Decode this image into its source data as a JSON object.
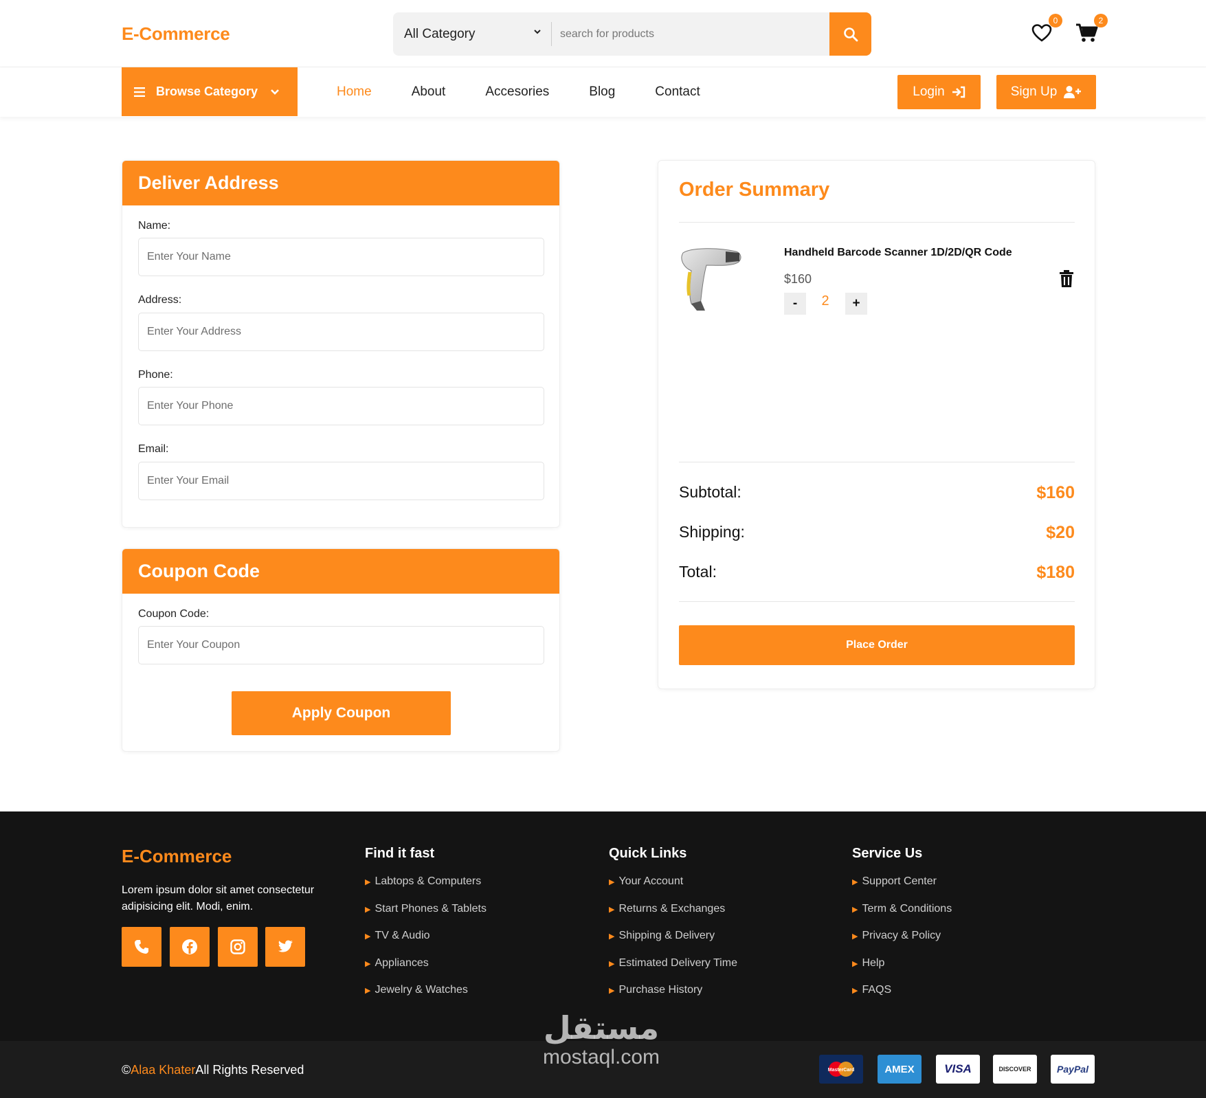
{
  "brand": {
    "name": "E-Commerce",
    "accent": "#fd8a1c"
  },
  "header": {
    "category_select": "All Category",
    "search_placeholder": "search for products",
    "wishlist_count": "0",
    "cart_count": "2"
  },
  "nav": {
    "browse_label": "Browse Category",
    "links": [
      "Home",
      "About",
      "Accesories",
      "Blog",
      "Contact"
    ],
    "active": "Home",
    "login_label": "Login",
    "signup_label": "Sign Up"
  },
  "address_form": {
    "title": "Deliver Address",
    "name_label": "Name:",
    "name_placeholder": "Enter Your Name",
    "address_label": "Address:",
    "address_placeholder": "Enter Your Address",
    "phone_label": "Phone:",
    "phone_placeholder": "Enter Your Phone",
    "email_label": "Email:",
    "email_placeholder": "Enter Your Email"
  },
  "coupon": {
    "title": "Coupon Code",
    "label": "Coupon Code:",
    "placeholder": "Enter Your Coupon",
    "button": "Apply Coupon"
  },
  "order_summary": {
    "title": "Order Summary",
    "item": {
      "name": "Handheld Barcode Scanner 1D/2D/QR Code",
      "price": "$160",
      "quantity": "2",
      "minus": "-",
      "plus": "+"
    },
    "subtotal_label": "Subtotal:",
    "subtotal_value": "$160",
    "shipping_label": "Shipping:",
    "shipping_value": "$20",
    "total_label": "Total:",
    "total_value": "$180",
    "place_order": "Place Order"
  },
  "footer": {
    "brand": "E-Commerce",
    "description": "Lorem ipsum dolor sit amet consectetur adipisicing elit. Modi, enim.",
    "social_icons": [
      "phone-icon",
      "facebook-icon",
      "instagram-icon",
      "twitter-icon"
    ],
    "col1": {
      "title": "Find it fast",
      "items": [
        "Labtops & Computers",
        "Start Phones & Tablets",
        "TV & Audio",
        "Appliances",
        "Jewelry & Watches"
      ]
    },
    "col2": {
      "title": "Quick Links",
      "items": [
        "Your Account",
        "Returns & Exchanges",
        "Shipping & Delivery",
        "Estimated Delivery Time",
        "Purchase History"
      ]
    },
    "col3": {
      "title": "Service Us",
      "items": [
        "Support Center",
        "Term & Conditions",
        "Privacy & Policy",
        "Help",
        "FAQS"
      ]
    },
    "copyright_symbol": "©",
    "copyright_name": "Alaa Khater",
    "copyright_text": "All Rights Reserved",
    "payment_methods": [
      "MasterCard",
      "AMEX",
      "VISA",
      "DISCOVER",
      "PayPal"
    ]
  },
  "watermark": {
    "arabic": "مستقل",
    "latin": "mostaql.com"
  }
}
